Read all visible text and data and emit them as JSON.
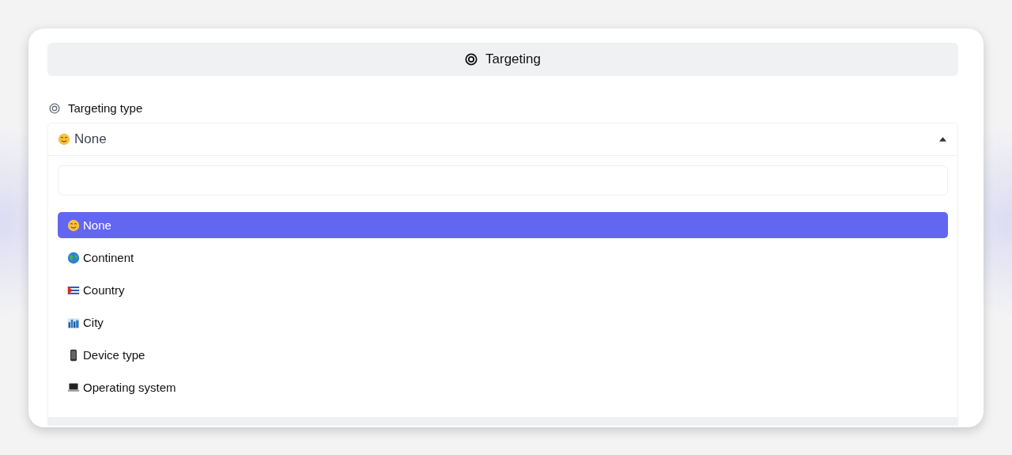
{
  "header": {
    "title": "Targeting"
  },
  "field": {
    "label": "Targeting type",
    "value": "None",
    "kind": "smile",
    "expanded": true
  },
  "options": [
    {
      "label": "None",
      "kind": "smile",
      "selected": true
    },
    {
      "label": "Continent",
      "kind": "globe",
      "selected": false
    },
    {
      "label": "Country",
      "kind": "flag",
      "selected": false
    },
    {
      "label": "City",
      "kind": "city",
      "selected": false
    },
    {
      "label": "Device type",
      "kind": "phone",
      "selected": false
    },
    {
      "label": "Operating system",
      "kind": "laptop",
      "selected": false
    }
  ]
}
